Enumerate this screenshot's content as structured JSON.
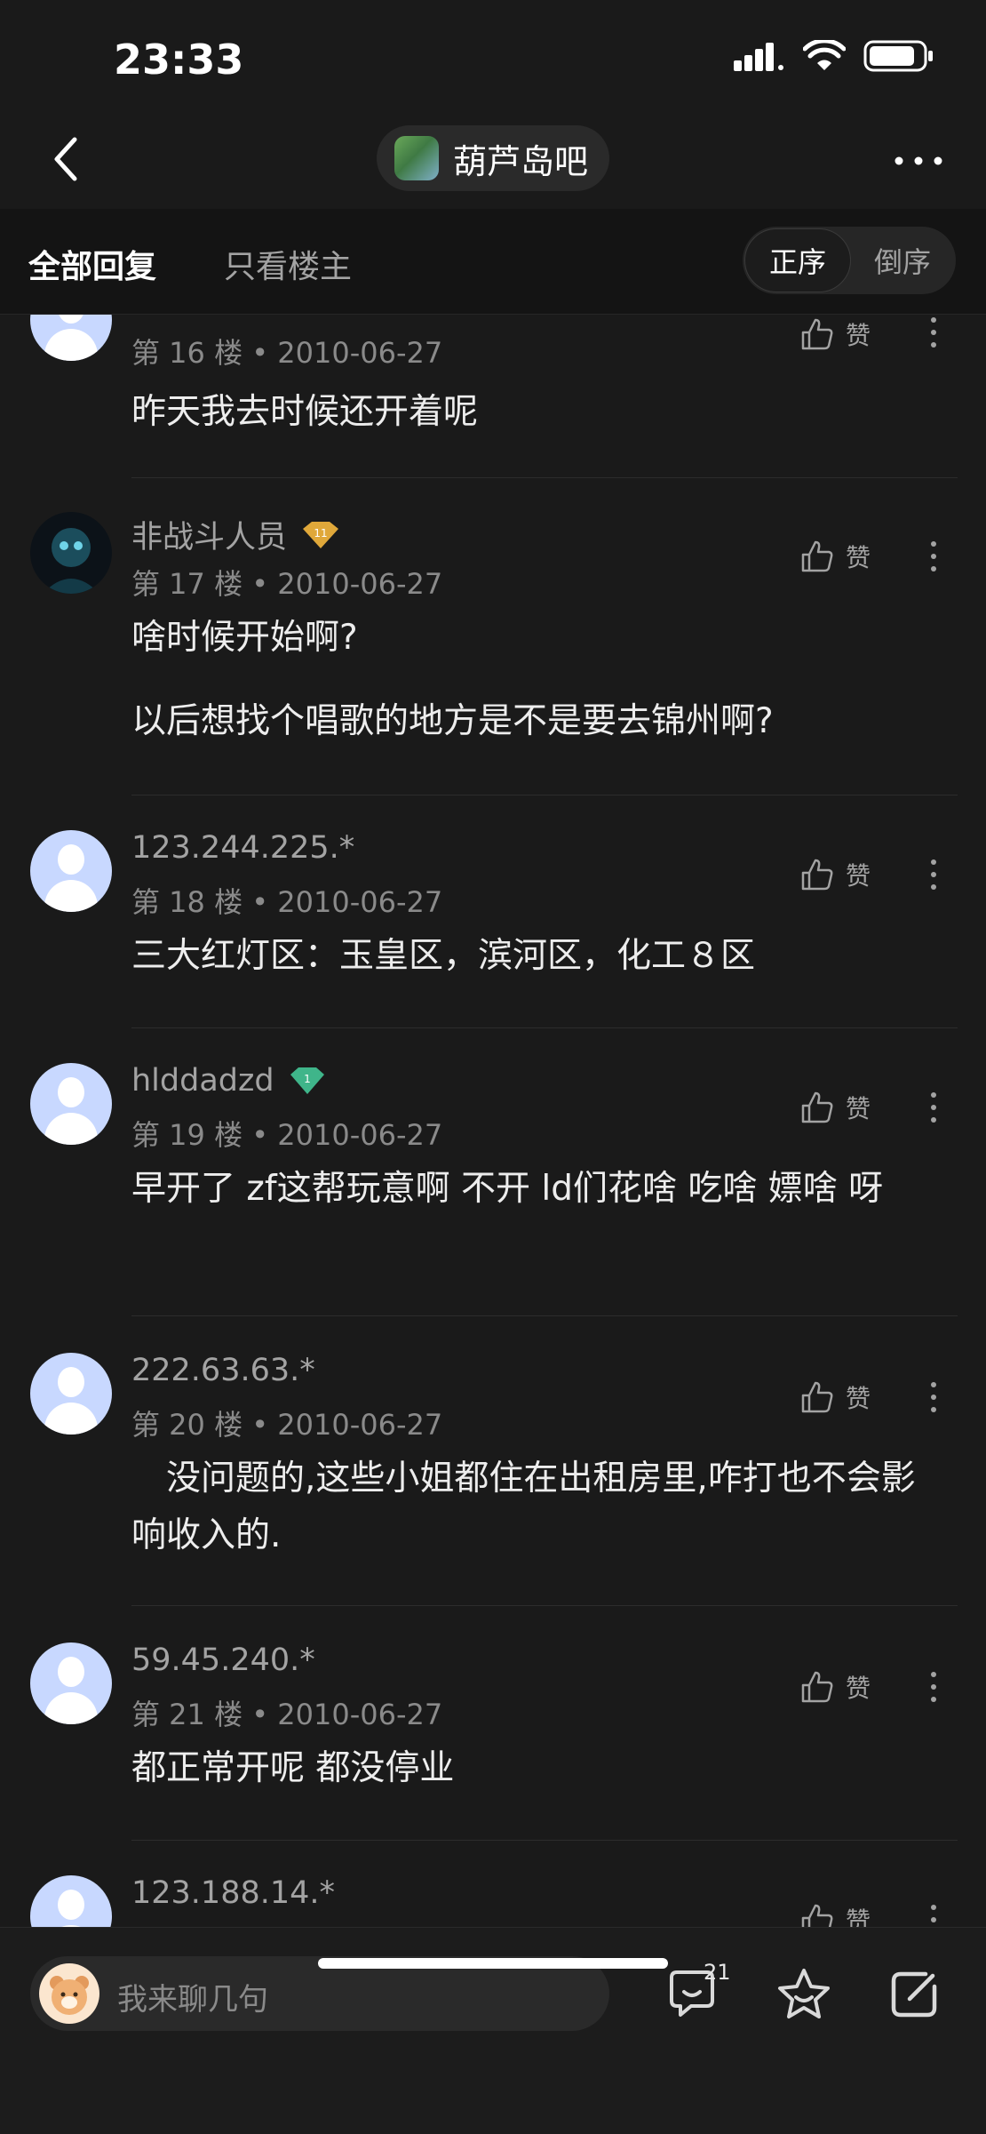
{
  "status_bar": {
    "time": "23:33"
  },
  "nav": {
    "forum_name": "葫芦岛吧"
  },
  "tabs": {
    "all": "全部回复",
    "owner_only": "只看楼主"
  },
  "order": {
    "asc": "正序",
    "desc": "倒序"
  },
  "like_label": "赞",
  "comments": [
    {
      "user": "",
      "floor": "第 16 楼",
      "date": "2010-06-27",
      "text": "昨天我去时候还开着呢"
    },
    {
      "user": "非战斗人员",
      "level": "11",
      "floor": "第 17 楼",
      "date": "2010-06-27",
      "text": "啥时候开始啊?",
      "text2": "以后想找个唱歌的地方是不是要去锦州啊?"
    },
    {
      "user": "123.244.225.*",
      "floor": "第 18 楼",
      "date": "2010-06-27",
      "text": "三大红灯区：玉皇区，滨河区，化工８区"
    },
    {
      "user": "hlddadzd",
      "level": "1",
      "floor": "第 19 楼",
      "date": "2010-06-27",
      "text": "早开了 zf这帮玩意啊 不开 ld们花啥 吃啥 嫖啥 呀"
    },
    {
      "user": "222.63.63.*",
      "floor": "第 20 楼",
      "date": "2010-06-27",
      "text": "　没问题的,这些小姐都住在出租房里,咋打也不会影响收入的."
    },
    {
      "user": "59.45.240.*",
      "floor": "第 21 楼",
      "date": "2010-06-27",
      "text": "都正常开呢 都没停业"
    },
    {
      "user": "123.188.14.*",
      "floor": "",
      "date": "",
      "text": ""
    }
  ],
  "bottom": {
    "placeholder": "我来聊几句",
    "comment_count": "21"
  },
  "colors": {
    "background": "#1a1a1a",
    "avatar_default": "#c8d8ff",
    "badge_gold": "#e0a83a",
    "badge_green": "#3fb58a"
  }
}
